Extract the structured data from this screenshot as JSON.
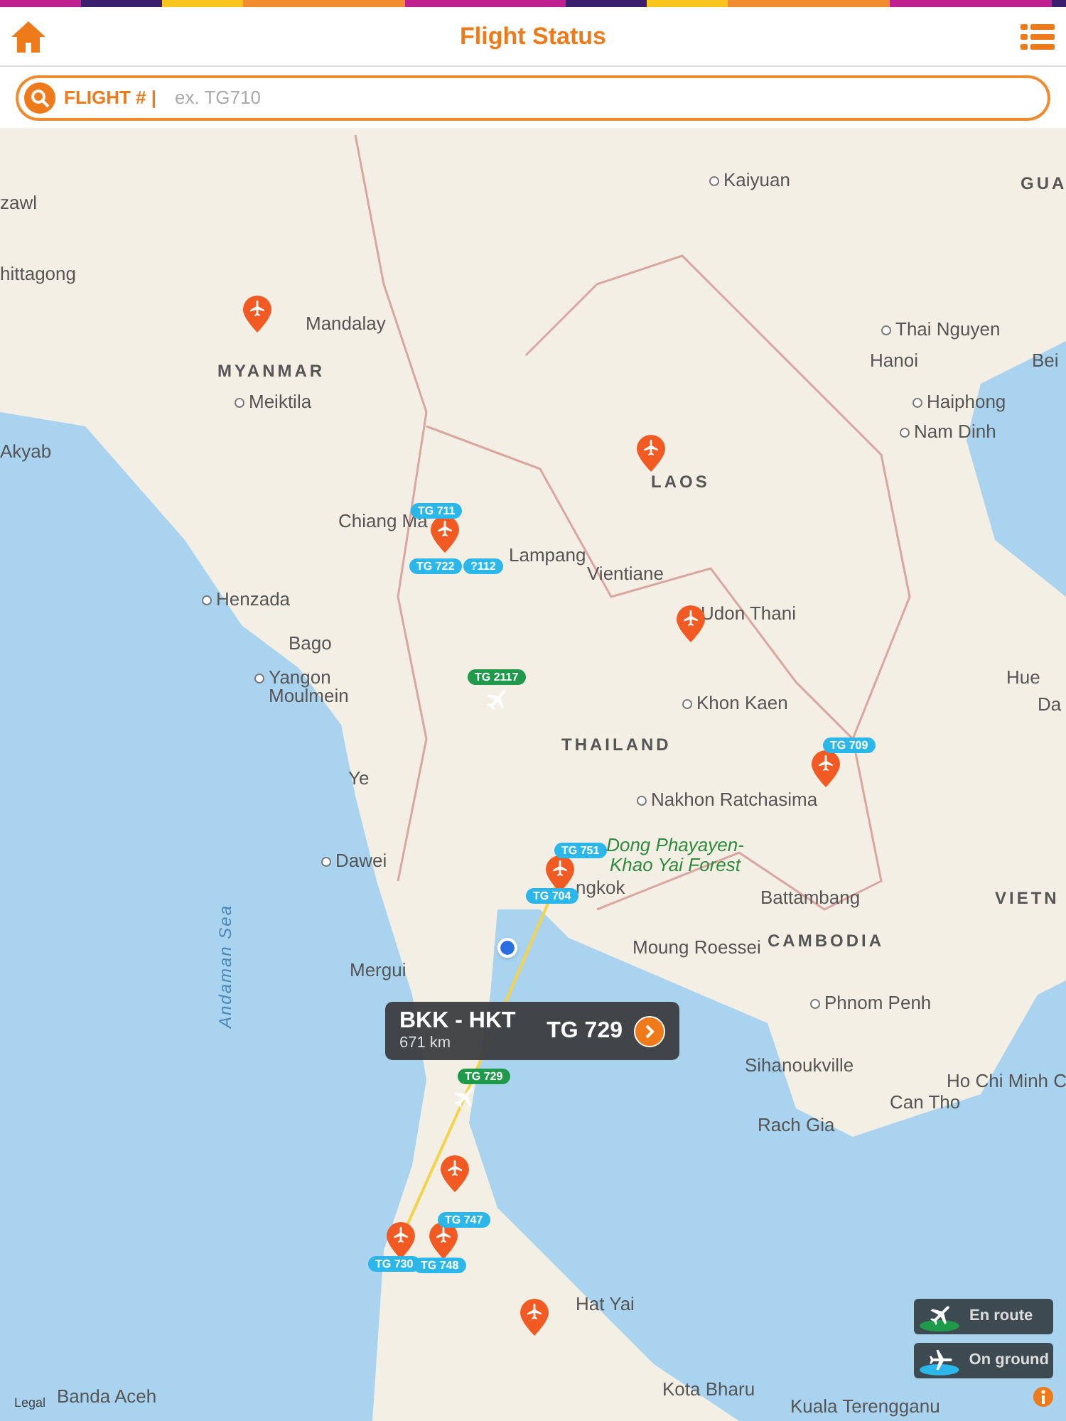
{
  "header": {
    "title": "Flight Status"
  },
  "search": {
    "label": "FLIGHT # |",
    "placeholder": "ex. TG710"
  },
  "map": {
    "places": [
      {
        "label": "zawl",
        "kind": "city"
      },
      {
        "label": "Kaiyuan",
        "kind": "city"
      },
      {
        "label": "GUA",
        "kind": "country"
      },
      {
        "label": "hittagong",
        "kind": "city"
      },
      {
        "label": "Mandalay",
        "kind": "city"
      },
      {
        "label": "MYANMAR",
        "kind": "country"
      },
      {
        "label": "Meiktila",
        "kind": "city"
      },
      {
        "label": "Thai Nguyen",
        "kind": "city"
      },
      {
        "label": "Hanoi",
        "kind": "city"
      },
      {
        "label": "Bei",
        "kind": "city"
      },
      {
        "label": "Haiphong",
        "kind": "city"
      },
      {
        "label": "Nam Dinh",
        "kind": "city"
      },
      {
        "label": "Akyab",
        "kind": "city"
      },
      {
        "label": "LAOS",
        "kind": "country"
      },
      {
        "label": "Chiang Ma",
        "kind": "city"
      },
      {
        "label": "Lampang",
        "kind": "city"
      },
      {
        "label": "Vientiane",
        "kind": "city"
      },
      {
        "label": "Henzada",
        "kind": "city"
      },
      {
        "label": "Udon Thani",
        "kind": "city"
      },
      {
        "label": "Bago",
        "kind": "city"
      },
      {
        "label": "Yangon",
        "kind": "city"
      },
      {
        "label": "Moulmein",
        "kind": "city"
      },
      {
        "label": "Khon Kaen",
        "kind": "city"
      },
      {
        "label": "Hue",
        "kind": "city"
      },
      {
        "label": "Da",
        "kind": "city"
      },
      {
        "label": "THAILAND",
        "kind": "country"
      },
      {
        "label": "Ye",
        "kind": "city"
      },
      {
        "label": "Nakhon Ratchasima",
        "kind": "city"
      },
      {
        "label": "Dawei",
        "kind": "city"
      },
      {
        "label": "Dong Phayayen-Khao Yai Forest",
        "kind": "park"
      },
      {
        "label": "ngkok",
        "kind": "city"
      },
      {
        "label": "Battambang",
        "kind": "city"
      },
      {
        "label": "VIETN",
        "kind": "country"
      },
      {
        "label": "Andaman Sea",
        "kind": "sea"
      },
      {
        "label": "Moung Roessei",
        "kind": "city"
      },
      {
        "label": "CAMBODIA",
        "kind": "country"
      },
      {
        "label": "Mergui",
        "kind": "city"
      },
      {
        "label": "Phnom Penh",
        "kind": "city"
      },
      {
        "label": "Sihanoukville",
        "kind": "city"
      },
      {
        "label": "Ho Chi Minh C",
        "kind": "city"
      },
      {
        "label": "Can Tho",
        "kind": "city"
      },
      {
        "label": "Rach Gia",
        "kind": "city"
      },
      {
        "label": "Hat Yai",
        "kind": "city"
      },
      {
        "label": "Banda Aceh",
        "kind": "city"
      },
      {
        "label": "Kota Bharu",
        "kind": "city"
      },
      {
        "label": "Kuala Terengganu",
        "kind": "city"
      }
    ],
    "flights": [
      {
        "label": "TG 711",
        "kind": "on_ground"
      },
      {
        "label": "TG 722",
        "kind": "on_ground"
      },
      {
        "label": "?112",
        "kind": "on_ground"
      },
      {
        "label": "TG 2117",
        "kind": "en_route"
      },
      {
        "label": "TG 709",
        "kind": "on_ground"
      },
      {
        "label": "TG 751",
        "kind": "on_ground"
      },
      {
        "label": "TG 704",
        "kind": "on_ground"
      },
      {
        "label": "TG 729",
        "kind": "en_route"
      },
      {
        "label": "TG 747",
        "kind": "on_ground"
      },
      {
        "label": "TG 730",
        "kind": "on_ground"
      },
      {
        "label": "TG 748",
        "kind": "on_ground"
      }
    ],
    "callout": {
      "route": "BKK - HKT",
      "distance": "671 km",
      "flight": "TG 729"
    },
    "legal": "Legal"
  },
  "legend": [
    {
      "label": "En route",
      "kind": "en_route"
    },
    {
      "label": "On ground",
      "kind": "on_ground"
    }
  ]
}
